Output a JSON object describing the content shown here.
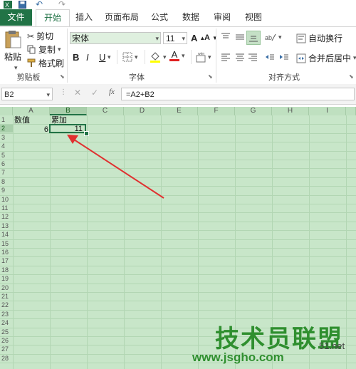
{
  "quick_access": {
    "undo_symbol": "↶",
    "redo_symbol": "↷"
  },
  "tabs": [
    "文件",
    "开始",
    "插入",
    "页面布局",
    "公式",
    "数据",
    "审阅",
    "视图"
  ],
  "clipboard": {
    "paste": "粘贴",
    "cut": "剪切",
    "copy": "复制",
    "format_painter": "格式刷",
    "group_label": "剪贴板"
  },
  "font": {
    "name": "宋体",
    "size": "11",
    "bold": "B",
    "italic": "I",
    "underline": "U",
    "grow": "A",
    "shrink": "A",
    "color_letter": "A",
    "group_label": "字体"
  },
  "alignment": {
    "wrap_text": "自动换行",
    "merge_center": "合并后居中",
    "group_label": "对齐方式"
  },
  "formula_bar": {
    "name_box": "B2",
    "fx": "fx",
    "formula": "=A2+B2"
  },
  "columns": [
    "A",
    "B",
    "C",
    "D",
    "E",
    "F",
    "G",
    "H",
    "I"
  ],
  "rows": [
    "1",
    "2",
    "3",
    "4",
    "5",
    "6",
    "7",
    "8",
    "9",
    "10",
    "11",
    "12",
    "13",
    "14",
    "15",
    "16",
    "17",
    "18",
    "19",
    "20",
    "21",
    "22",
    "23",
    "24",
    "25",
    "26",
    "27",
    "28"
  ],
  "cells": {
    "A1": "数值",
    "B1": "累加",
    "A2": "6",
    "B2": "11"
  },
  "watermark": {
    "main": "技术员联盟",
    "site": "www.jsgho.com",
    "suffix": "51.net"
  },
  "colors": {
    "excel_green": "#217346",
    "sheet_bg": "#c8e6c9",
    "arrow": "#e03030"
  }
}
